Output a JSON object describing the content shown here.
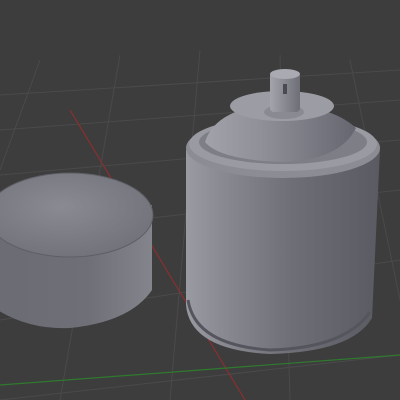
{
  "viewport": {
    "kind": "3D viewport (perspective)",
    "background_color": "#3d3d3d",
    "grid_line_color": "#4a4a4a",
    "x_axis_color": "#8a2f2f",
    "y_axis_color": "#2f7a2f"
  },
  "objects": [
    {
      "name": "cap",
      "shape": "cylinder",
      "color": "#77777f"
    },
    {
      "name": "spray-can",
      "shape": "cylinder with dome top and nozzle",
      "color": "#7d7d85"
    }
  ]
}
